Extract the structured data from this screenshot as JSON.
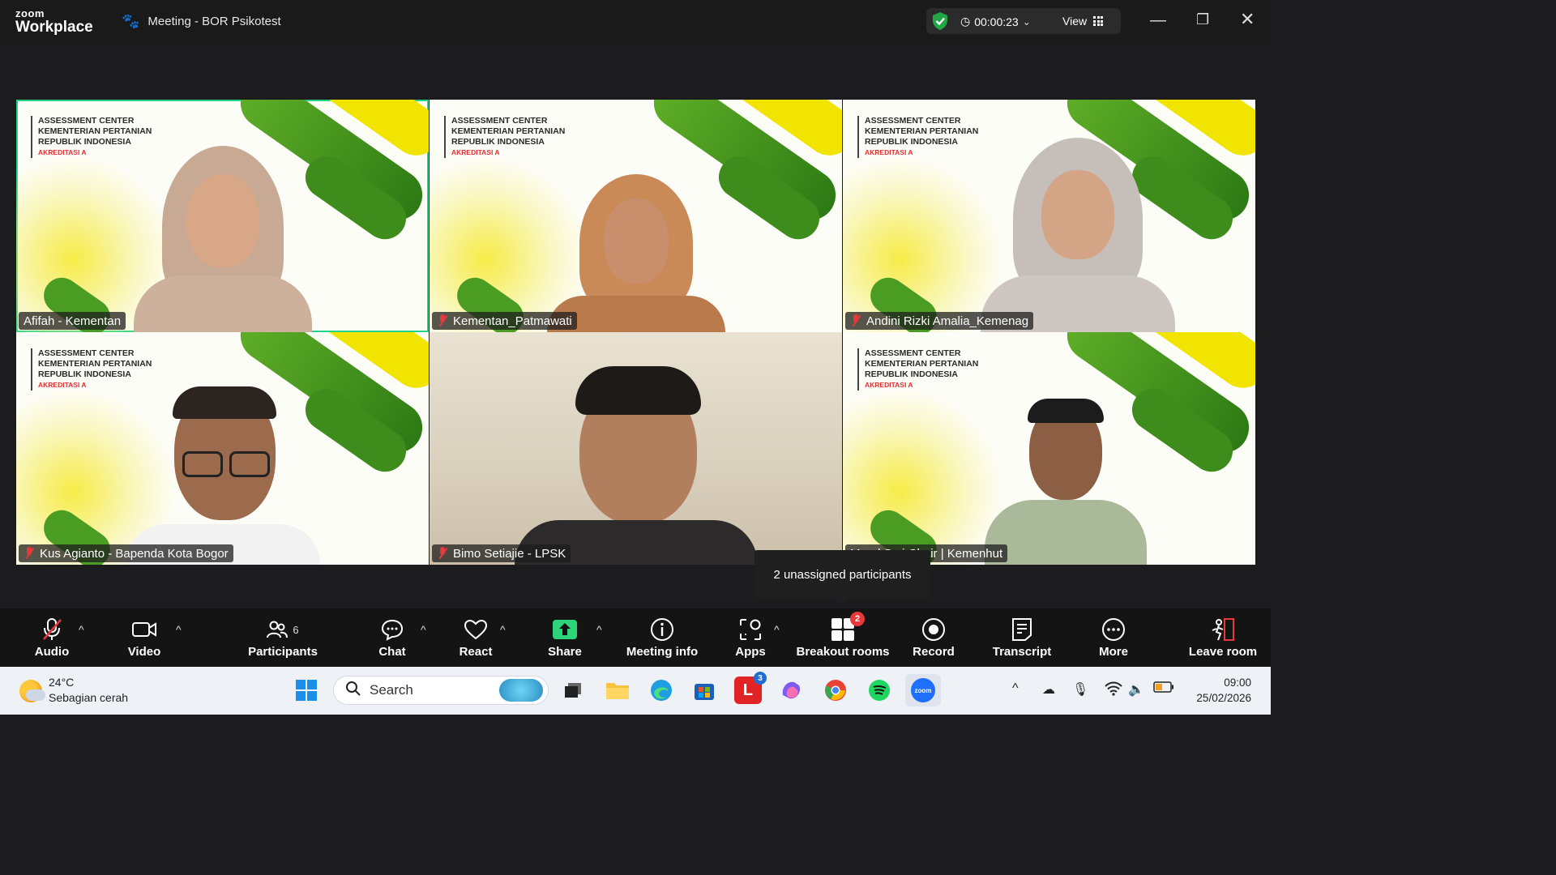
{
  "titlebar": {
    "logo_top": "zoom",
    "logo_bottom": "Workplace",
    "meeting_title": "Meeting - BOR Psikotest",
    "timer": "00:00:23",
    "view_label": "View",
    "shield_color": "#22a745"
  },
  "org_text": {
    "line1": "ASSESSMENT CENTER",
    "line2": "KEMENTERIAN PERTANIAN",
    "line3": "REPUBLIK INDONESIA",
    "line4": "AKREDITASI A"
  },
  "participants": [
    {
      "name": "Afifah - Kementan",
      "muted": false,
      "active": true
    },
    {
      "name": "Kementan_Patmawati",
      "muted": true,
      "active": false
    },
    {
      "name": "Andini Rizki Amalia_Kemenag",
      "muted": true,
      "active": false
    },
    {
      "name": "Kus Agianto - Bapenda Kota Bogor",
      "muted": true,
      "active": false
    },
    {
      "name": "Bimo Setiajie - LPSK",
      "muted": true,
      "active": false
    },
    {
      "name": "Muhammad Sabri Chair | Kemenhut",
      "visible_name": "M...  d S...i Chair | Kemenhut",
      "muted": false,
      "active": false
    }
  ],
  "tooltip": "2 unassigned participants",
  "toolbar": {
    "audio": "Audio",
    "video": "Video",
    "participants": "Participants",
    "participants_count": "6",
    "chat": "Chat",
    "react": "React",
    "share": "Share",
    "meeting_info": "Meeting info",
    "apps": "Apps",
    "breakout_rooms": "Breakout rooms",
    "breakout_badge": "2",
    "record": "Record",
    "transcript": "Transcript",
    "more": "More",
    "leave": "Leave room"
  },
  "taskbar": {
    "temp": "24°C",
    "weather": "Sebagian cerah",
    "search_placeholder": "Search",
    "l_badge": "3",
    "time": "09:00",
    "date": "25/02/2026"
  }
}
